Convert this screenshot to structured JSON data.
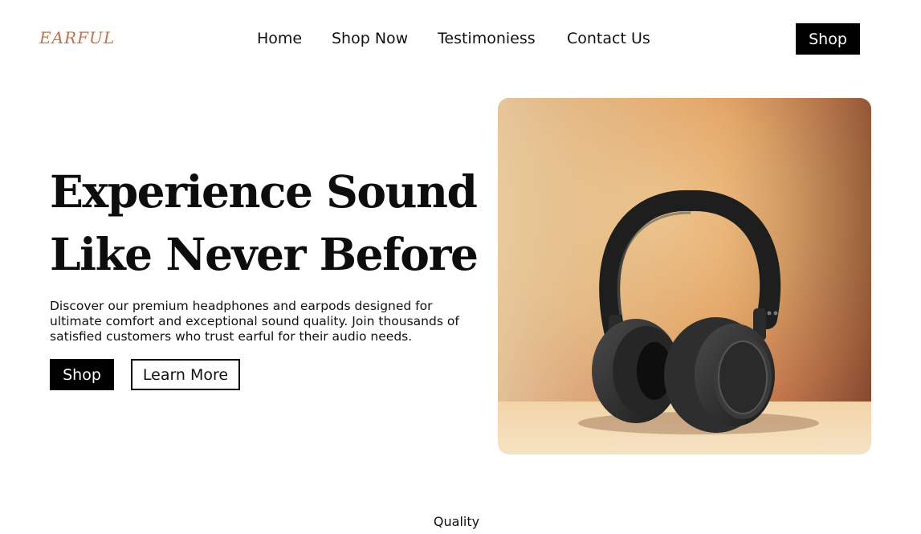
{
  "brand": {
    "logo_text": "EARFUL",
    "accent_color": "#c0734a"
  },
  "nav": {
    "items": [
      {
        "label": "Home"
      },
      {
        "label": "Shop Now"
      },
      {
        "label": "Testimoniess"
      },
      {
        "label": "Contact Us"
      }
    ],
    "cta_label": "Shop"
  },
  "hero": {
    "title_line1": "Experience Sound",
    "title_line2": "Like Never Before",
    "description": "Discover our premium headphones and earpods designed for ultimate comfort and exceptional sound quality. Join thousands of satisfied customers who trust earful for their audio needs.",
    "primary_button": "Shop",
    "secondary_button": "Learn More",
    "image": {
      "subject": "headphones-image"
    }
  },
  "next_section": {
    "label": "Quality"
  }
}
